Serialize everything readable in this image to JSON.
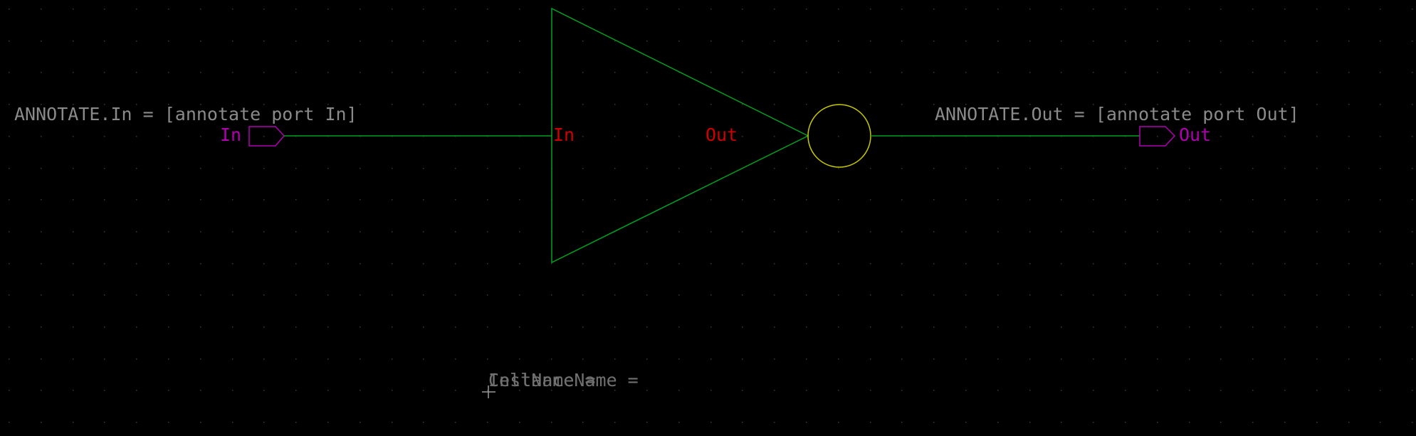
{
  "colors": {
    "background": "#000000",
    "grid_dot": "#3a3a3a",
    "wire": "#00a020",
    "symbol_body": "#00a020",
    "inversion_bubble": "#c8c800",
    "io_pin": "#b000b0",
    "pin_label": "#d00000",
    "annotation_text": "#8a8a8a",
    "attribute_text": "#707070",
    "origin_marker": "#9a9a9a"
  },
  "annotations": {
    "in_annotation": "ANNOTATE.In = [annotate port In]",
    "out_annotation": "ANNOTATE.Out = [annotate port Out]"
  },
  "io_pins": {
    "input_label": "In",
    "output_label": "Out"
  },
  "symbol": {
    "input_pin_label": "In",
    "output_pin_label": "Out"
  },
  "attributes": {
    "cell_name_label": "CellName =",
    "instance_name_label": "InstanceName ="
  },
  "icons": {
    "origin_marker": "crosshair-icon",
    "input_pin": "pentagon-pin-icon",
    "output_pin": "pentagon-pin-icon"
  }
}
